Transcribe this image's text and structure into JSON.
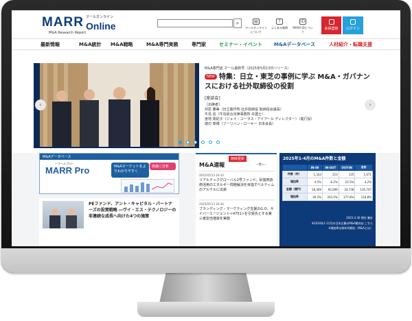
{
  "header": {
    "logo_main": "MARR",
    "logo_online": "Online",
    "logo_tagline": "マールオンライン",
    "logo_sub": "M&A Research Report",
    "icons": [
      {
        "label": "マールオンラインについて",
        "icon": "book-icon"
      },
      {
        "label": "よくある質問",
        "icon": "question-icon"
      },
      {
        "label": "MARR IDについて",
        "icon": "id-card-icon"
      }
    ],
    "register_label": "会員登録",
    "login_label": "ログイン"
  },
  "nav": {
    "items": [
      "最新情報",
      "M&A統計",
      "M&A戦略",
      "M&A専門実務",
      "専門家",
      "セミナー・イベント",
      "M&Aデータベース",
      "人材紹介・転職支援"
    ],
    "colors": [
      "#222222",
      "#222222",
      "#222222",
      "#222222",
      "#222222",
      "#1a9a3a",
      "#1d5fa0",
      "#d7262e"
    ]
  },
  "hero": {
    "date": "M&A専門誌 マール最新号（2025年5月13日リリース）",
    "new_badge": "NEW",
    "title": "特集：日立・東芝の事例に学ぶ M&A・ガバナンスにおける社外取締役の役割",
    "kind": "[座談会]",
    "attendees_head": "［出席者］",
    "attendees": [
      "井原 勝美（日立製作所 社外取締役 取締役会議長）",
      "牛島 信（牛島総合法律事務所 弁護士）",
      "宮地 真紀子（ジェイ・ユーラス・アイアール ディレクター）（進行役）",
      "渡辺 章博（フーリハン・ローキー 日本会長）"
    ],
    "prev": "‹",
    "next": "›",
    "slide_count": 6,
    "active_slide": 1
  },
  "database_box": {
    "header": "M&Aデータベース",
    "brand_tag": "―マールプロ―",
    "brand": "MARR Pro",
    "bubble1": "M&Aマーケットをよりわかりやすく",
    "bubble2": "高度に分析"
  },
  "article": {
    "title": "PEファンド、アント・キャピタル・パートナーズの投資戦略 ―ヴイ・エス・テクノロジーの非連続な成長へ向けた4つの施策"
  },
  "sokuho": {
    "title": "M&A速報",
    "badge": "随時更新",
    "more": "一覧へ ›",
    "items": [
      {
        "date": "2025/05/13 16:33",
        "text": "リアルテックグローバル2号ファンド、砂富熱技術活用のエネルギー問題解決を目指すベルティムのアルテルに出資"
      },
      {
        "date": "2025/05/13 16:30",
        "text": "ブランディング・マーケティング支援のG.O、サイバーエージェント<4751>を引受先とする第三者割当増資を実施"
      }
    ]
  },
  "stats": {
    "title": "2025年1-4月のM&A件数と金額",
    "columns": [
      "",
      "IN-IN",
      "IN-OUT",
      "OUT-IN",
      "合計"
    ],
    "rows": [
      [
        "件数（件）",
        "1,333",
        "213",
        "125",
        "1,671"
      ],
      [
        "増加率",
        "4.5%",
        "-6.2%",
        "22.5%",
        "4.2%"
      ],
      [
        "金額（億円）",
        "18,309",
        "92,699",
        "24,738",
        "135,747"
      ],
      [
        "増加率",
        "-30.5%",
        "203.5%",
        "377.8%",
        "118.8%"
      ]
    ],
    "as_of": "2025.4.30 現在 集計",
    "note1": "※2024年1-12月の日本企業のM&A動向は こちら",
    "note2": "※増加率は前年同期比［M&Aとは］"
  }
}
